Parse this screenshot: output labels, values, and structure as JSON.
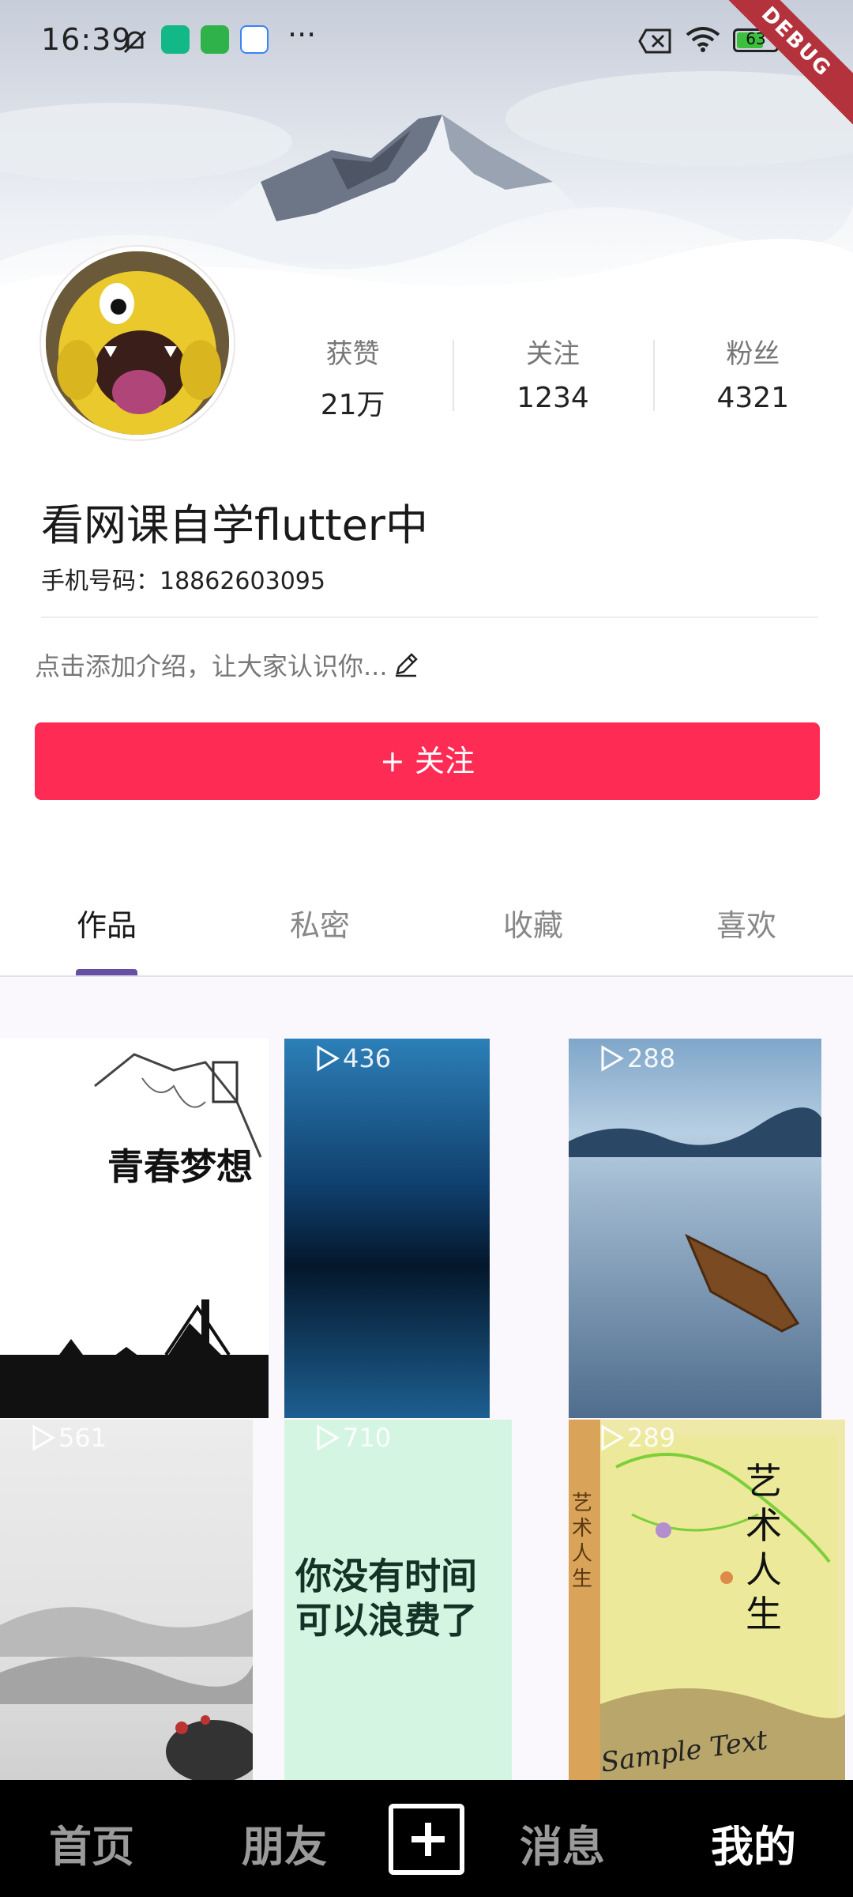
{
  "status_bar": {
    "time": "16:39",
    "battery_level": "63",
    "battery_fraction": 0.63,
    "debug_label": "DEBUG",
    "more_label": "···"
  },
  "profile": {
    "stats": [
      {
        "label": "获赞",
        "value": "21万"
      },
      {
        "label": "关注",
        "value": "1234"
      },
      {
        "label": "粉丝",
        "value": "4321"
      }
    ],
    "nickname": "看网课自学flutter中",
    "phone": "手机号码：18862603095",
    "intro": "点击添加介绍，让大家认识你...",
    "follow_button": "+ 关注"
  },
  "tabs": [
    {
      "label": "作品",
      "active": true
    },
    {
      "label": "私密",
      "active": false
    },
    {
      "label": "收藏",
      "active": false
    },
    {
      "label": "喜欢",
      "active": false
    }
  ],
  "videos": [
    {
      "plays": "",
      "title_text": "青春梦想",
      "theme": "great-wall-sketch"
    },
    {
      "plays": "436",
      "title_text": "",
      "theme": "blue-glitter"
    },
    {
      "plays": "288",
      "title_text": "",
      "theme": "lake-boat"
    },
    {
      "plays": "561",
      "title_text": "",
      "theme": "ink-landscape"
    },
    {
      "plays": "710",
      "title_text": "你没有时间\n可以浪费了",
      "theme": "mint-quote"
    },
    {
      "plays": "289",
      "title_text": "艺术人生",
      "theme": "art-book",
      "book_spine": "艺术人生",
      "book_script": "Sample Text"
    }
  ],
  "bottom_nav": {
    "items": [
      {
        "label": "首页",
        "active": false
      },
      {
        "label": "朋友",
        "active": false
      },
      {
        "label": "消息",
        "active": false
      },
      {
        "label": "我的",
        "active": true
      }
    ],
    "add_icon": "plus-square-icon"
  },
  "colors": {
    "accent": "#fe2c55",
    "tab_indicator": "#6750a4",
    "nav_bg": "#000000"
  }
}
